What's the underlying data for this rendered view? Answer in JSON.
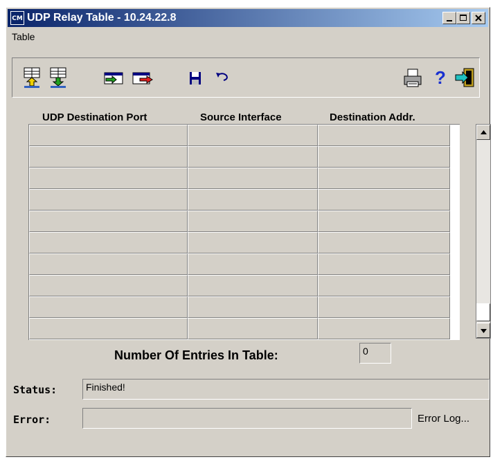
{
  "window": {
    "title": "UDP Relay Table - 10.24.22.8",
    "icon_label": "CM"
  },
  "menu": {
    "items": [
      {
        "label": "Table"
      }
    ]
  },
  "toolbar": {
    "icons": [
      "download-table-icon",
      "upload-table-icon",
      "insert-row-icon",
      "delete-row-icon",
      "save-icon",
      "undo-icon",
      "print-icon",
      "help-icon",
      "exit-icon"
    ]
  },
  "table": {
    "columns": [
      "UDP Destination Port",
      "Source Interface",
      "Destination Addr."
    ],
    "rows": [
      [
        "",
        "",
        ""
      ],
      [
        "",
        "",
        ""
      ],
      [
        "",
        "",
        ""
      ],
      [
        "",
        "",
        ""
      ],
      [
        "",
        "",
        ""
      ],
      [
        "",
        "",
        ""
      ],
      [
        "",
        "",
        ""
      ],
      [
        "",
        "",
        ""
      ],
      [
        "",
        "",
        ""
      ],
      [
        "",
        "",
        ""
      ]
    ]
  },
  "entries": {
    "label": "Number Of Entries In Table:",
    "value": "0"
  },
  "status": {
    "label": "Status:",
    "value": "Finished!"
  },
  "error": {
    "label": "Error:",
    "value": "",
    "log_label": "Error Log..."
  },
  "colors": {
    "title_bar_start": "#0a246a",
    "title_bar_end": "#a6caf0",
    "window_face": "#d4d0c8"
  }
}
